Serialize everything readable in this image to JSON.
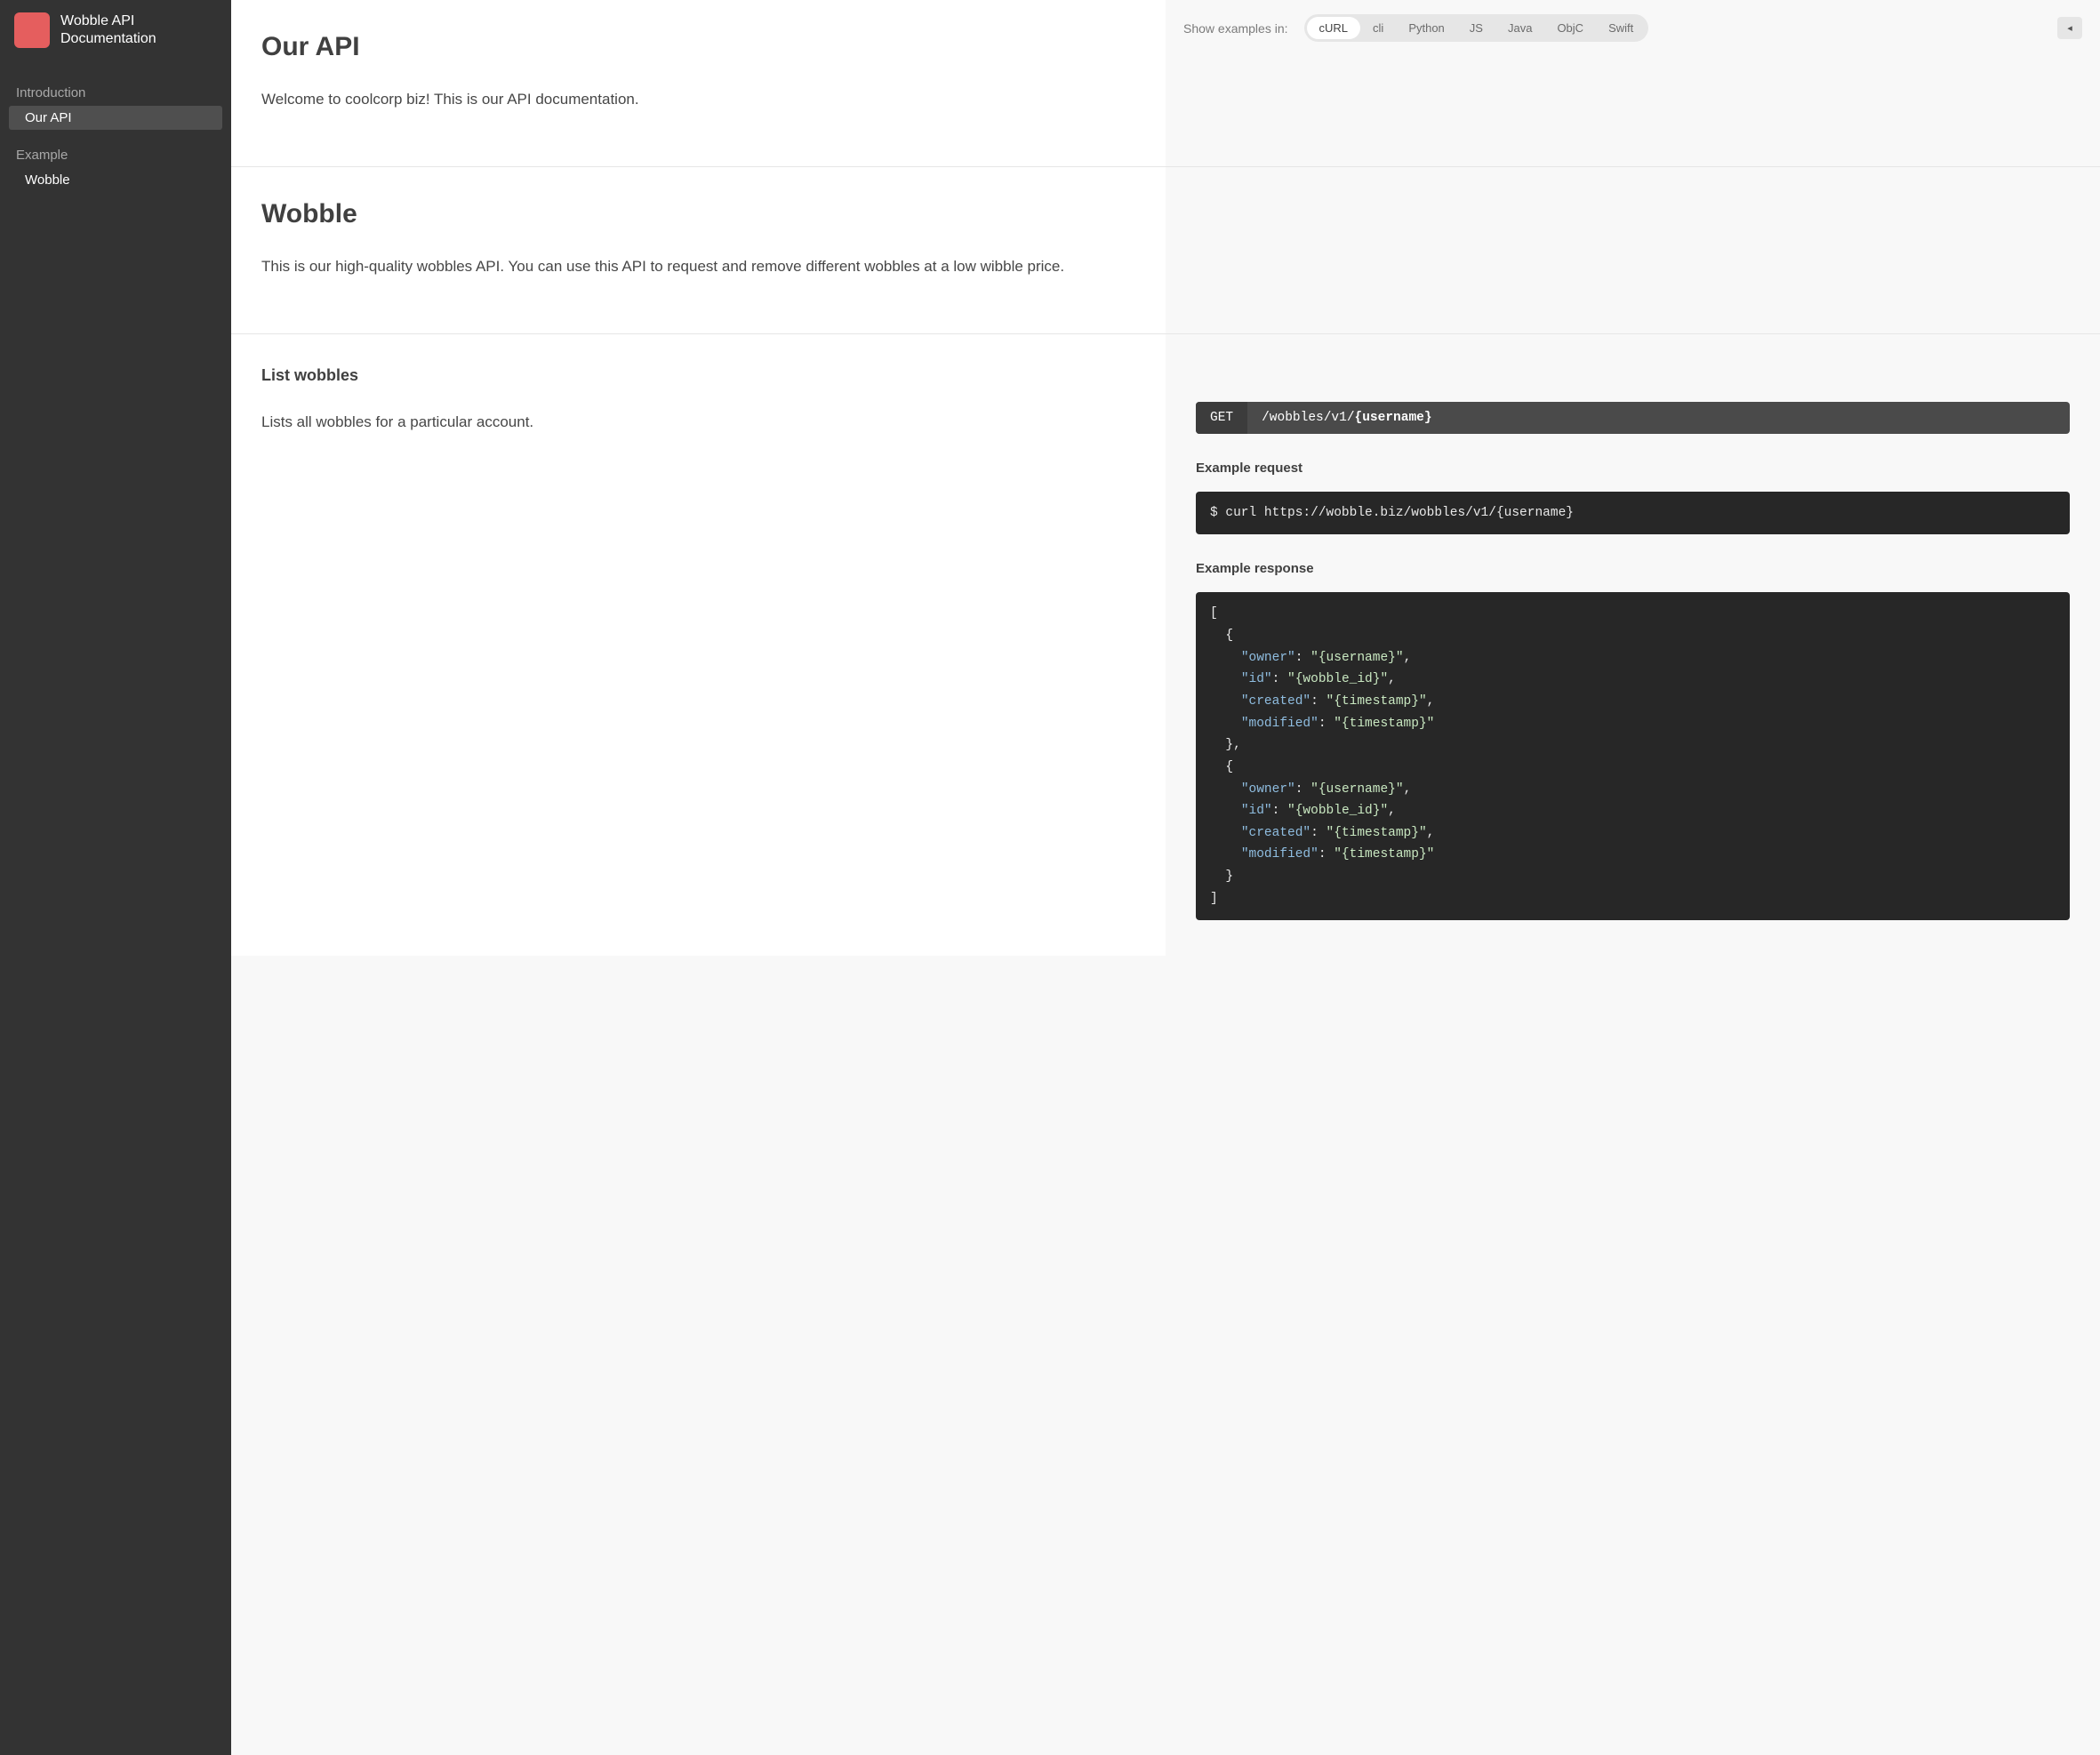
{
  "app": {
    "title": "Wobble API Documentation"
  },
  "sidebar": {
    "groups": [
      {
        "label": "Introduction",
        "items": [
          {
            "label": "Our API",
            "active": true
          }
        ]
      },
      {
        "label": "Example",
        "items": [
          {
            "label": "Wobble",
            "active": false
          }
        ]
      }
    ]
  },
  "toolbar": {
    "label": "Show examples in:",
    "languages": [
      "cURL",
      "cli",
      "Python",
      "JS",
      "Java",
      "ObjC",
      "Swift"
    ],
    "active_language": "cURL",
    "collapse_glyph": "◂"
  },
  "sections": {
    "our_api": {
      "title": "Our API",
      "body": "Welcome to coolcorp biz! This is our API documentation."
    },
    "wobble": {
      "title": "Wobble",
      "body": "This is our high-quality wobbles API. You can use this API to request and remove different wobbles at a low wibble price."
    },
    "list_wobbles": {
      "title": "List wobbles",
      "body": "Lists all wobbles for a particular account.",
      "endpoint": {
        "method": "GET",
        "path_prefix": "/wobbles/v1/",
        "path_param": "{username}"
      },
      "example_request": {
        "heading": "Example request",
        "code": "$ curl https://wobble.biz/wobbles/v1/{username}"
      },
      "example_response": {
        "heading": "Example response",
        "json": [
          {
            "owner": "{username}",
            "id": "{wobble_id}",
            "created": "{timestamp}",
            "modified": "{timestamp}"
          },
          {
            "owner": "{username}",
            "id": "{wobble_id}",
            "created": "{timestamp}",
            "modified": "{timestamp}"
          }
        ]
      }
    }
  }
}
